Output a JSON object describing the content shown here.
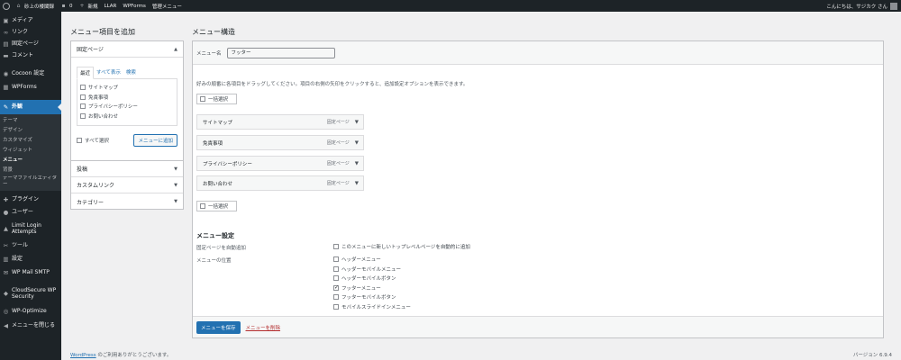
{
  "admin_bar": {
    "site_name": "砂上の楼閣録",
    "comments_count": "0",
    "new_label": "新規",
    "llar_label": "LLAR",
    "wpforms_label": "WPForms",
    "manage_menu_label": "管理メニュー",
    "greeting": "こんにちは、サジカク さん"
  },
  "sidebar": {
    "top_items": [
      {
        "label": "メディア",
        "icon": "media-icon"
      },
      {
        "label": "リンク",
        "icon": "link-icon"
      },
      {
        "label": "固定ページ",
        "icon": "page-icon"
      },
      {
        "label": "コメント",
        "icon": "comment-icon"
      }
    ],
    "mid_items": [
      {
        "label": "Cocoon 設定",
        "icon": "cocoon-icon"
      },
      {
        "label": "WPForms",
        "icon": "wpforms-icon"
      }
    ],
    "current": {
      "label": "外観",
      "icon": "brush-icon"
    },
    "submenu": [
      "テーマ",
      "デザイン",
      "カスタマイズ",
      "ウィジェット",
      "メニュー",
      "背景",
      "テーマファイルエディター"
    ],
    "bottom_items": [
      {
        "label": "プラグイン",
        "icon": "plugin-icon"
      },
      {
        "label": "ユーザー",
        "icon": "user-icon"
      },
      {
        "label": "Limit Login Attempts",
        "icon": "lock-icon"
      },
      {
        "label": "ツール",
        "icon": "wrench-icon"
      },
      {
        "label": "設定",
        "icon": "settings-icon"
      },
      {
        "label": "WP Mail SMTP",
        "icon": "mail-icon"
      },
      {
        "label": "CloudSecure WP Security",
        "icon": "shield-icon"
      },
      {
        "label": "WP-Optimize",
        "icon": "optimize-icon"
      },
      {
        "label": "メニューを閉じる",
        "icon": "collapse-icon"
      }
    ]
  },
  "add_items": {
    "title": "メニュー項目を追加",
    "pages_section": {
      "title": "固定ページ",
      "tabs": [
        "最近",
        "すべて表示",
        "検索"
      ],
      "pages": [
        "サイトマップ",
        "免責事項",
        "プライバシーポリシー",
        "お問い合わせ"
      ],
      "select_all": "すべて選択",
      "add_button": "メニューに追加"
    },
    "other_sections": [
      "投稿",
      "カスタムリンク",
      "カテゴリー"
    ]
  },
  "structure": {
    "title": "メニュー構造",
    "name_label": "メニュー名",
    "name_value": "フッター",
    "instructions": "好みの順番に各項目をドラッグしてください。項目の右側の矢印をクリックすると、追加設定オプションを表示できます。",
    "bulk_select": "一括選択",
    "items": [
      {
        "title": "サイトマップ",
        "type": "固定ページ"
      },
      {
        "title": "免責事項",
        "type": "固定ページ"
      },
      {
        "title": "プライバシーポリシー",
        "type": "固定ページ"
      },
      {
        "title": "お問い合わせ",
        "type": "固定ページ"
      }
    ]
  },
  "settings": {
    "title": "メニュー設定",
    "auto_add_label": "固定ページを自動追加",
    "auto_add_option": "このメニューに新しいトップレベルページを自動的に追加",
    "location_label": "メニューの位置",
    "locations": [
      {
        "label": "ヘッダーメニュー",
        "checked": false
      },
      {
        "label": "ヘッダーモバイルメニュー",
        "checked": false
      },
      {
        "label": "ヘッダーモバイルボタン",
        "checked": false
      },
      {
        "label": "フッターメニュー",
        "checked": true
      },
      {
        "label": "フッターモバイルボタン",
        "checked": false
      },
      {
        "label": "モバイルスライドインメニュー",
        "checked": false
      }
    ],
    "save_button": "メニューを保存",
    "delete_link": "メニューを削除"
  },
  "footer": {
    "wp_link": "WordPress",
    "thanks": " のご利用ありがとうございます。",
    "version": "バージョン 6.9.4"
  }
}
